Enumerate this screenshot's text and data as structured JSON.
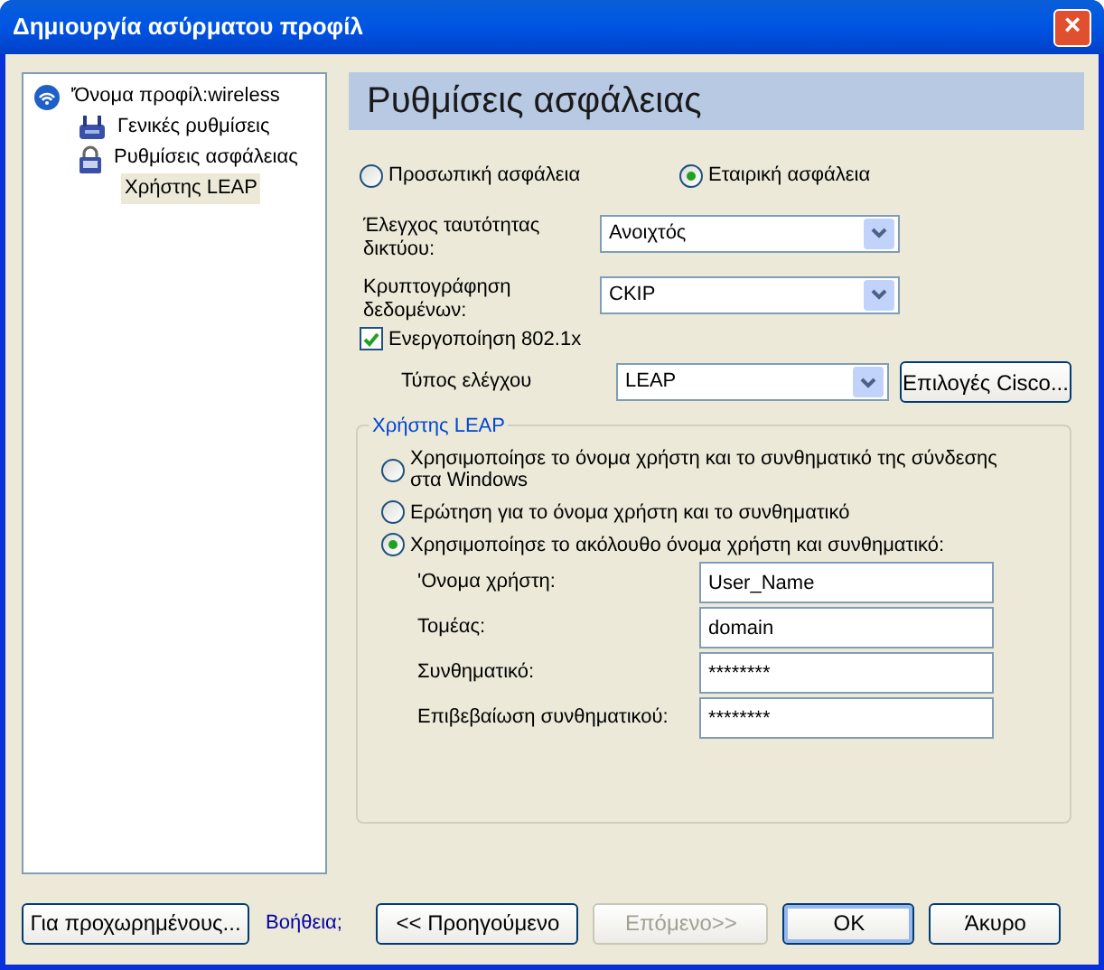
{
  "window": {
    "title": "Δημιουργία ασύρματου προφίλ",
    "close": "×"
  },
  "tree": [
    {
      "label": "'Όνομα προφίλ:wireless",
      "kind": "wifi",
      "selected": false,
      "children": [
        {
          "label": "Γενικές ρυθμίσεις",
          "kind": "network",
          "selected": false
        },
        {
          "label": "Ρυθμίσεις ασφάλειας",
          "kind": "lock",
          "selected": false,
          "children": [
            {
              "label": "Χρήστης LEAP",
              "selected": true
            }
          ]
        }
      ]
    }
  ],
  "heading": "Ρυθμίσεις ασφάλειας",
  "security_modes": [
    {
      "label": "Προσωπική ασφάλεια",
      "selected": false
    },
    {
      "label": "Εταιρική ασφάλεια",
      "selected": true
    }
  ],
  "network_auth": {
    "label": "Έλεγχος ταυτότητας δικτύου:",
    "value": "Ανοιχτός"
  },
  "data_encryption": {
    "label": "Κρυπτογράφηση δεδομένων:",
    "value": "CKIP"
  },
  "enable_8021x": {
    "label": "Ενεργοποίηση 802.1x",
    "checked": true
  },
  "auth_type": {
    "label": "Τύπος ελέγχου",
    "value": "LEAP",
    "button": "Επιλογές Cisco..."
  },
  "leap_group": {
    "title": "Χρήστης LEAP",
    "options": [
      {
        "label": "Χρησιμοποίησε το όνομα χρήστη και το συνθηματικό της σύνδεσης στα Windows",
        "selected": false
      },
      {
        "label": "Ερώτηση για το όνομα χρήστη και το συνθηματικό",
        "selected": false
      },
      {
        "label": "Χρησιμοποίησε το ακόλουθο όνομα χρήστη και συνθηματικό:",
        "selected": true
      }
    ],
    "fields": [
      {
        "label": "'Ονομα χρήστη:",
        "value": "User_Name"
      },
      {
        "label": "Τομέας:",
        "value": "domain"
      },
      {
        "label": "Συνθηματικό:",
        "value": "********"
      },
      {
        "label": "Επιβεβαίωση συνθηματικού:",
        "value": "********"
      }
    ]
  },
  "advanced_button": "Για προχωρημένους...",
  "help_link": "Βοήθεια;",
  "buttons": [
    {
      "label": "<< Προηγούμενο",
      "disabled": false,
      "default": false
    },
    {
      "label": "Επόμενο>>",
      "disabled": true,
      "default": false
    },
    {
      "label": "OK",
      "disabled": false,
      "default": true
    },
    {
      "label": "Άκυρο",
      "disabled": false,
      "default": false
    }
  ]
}
